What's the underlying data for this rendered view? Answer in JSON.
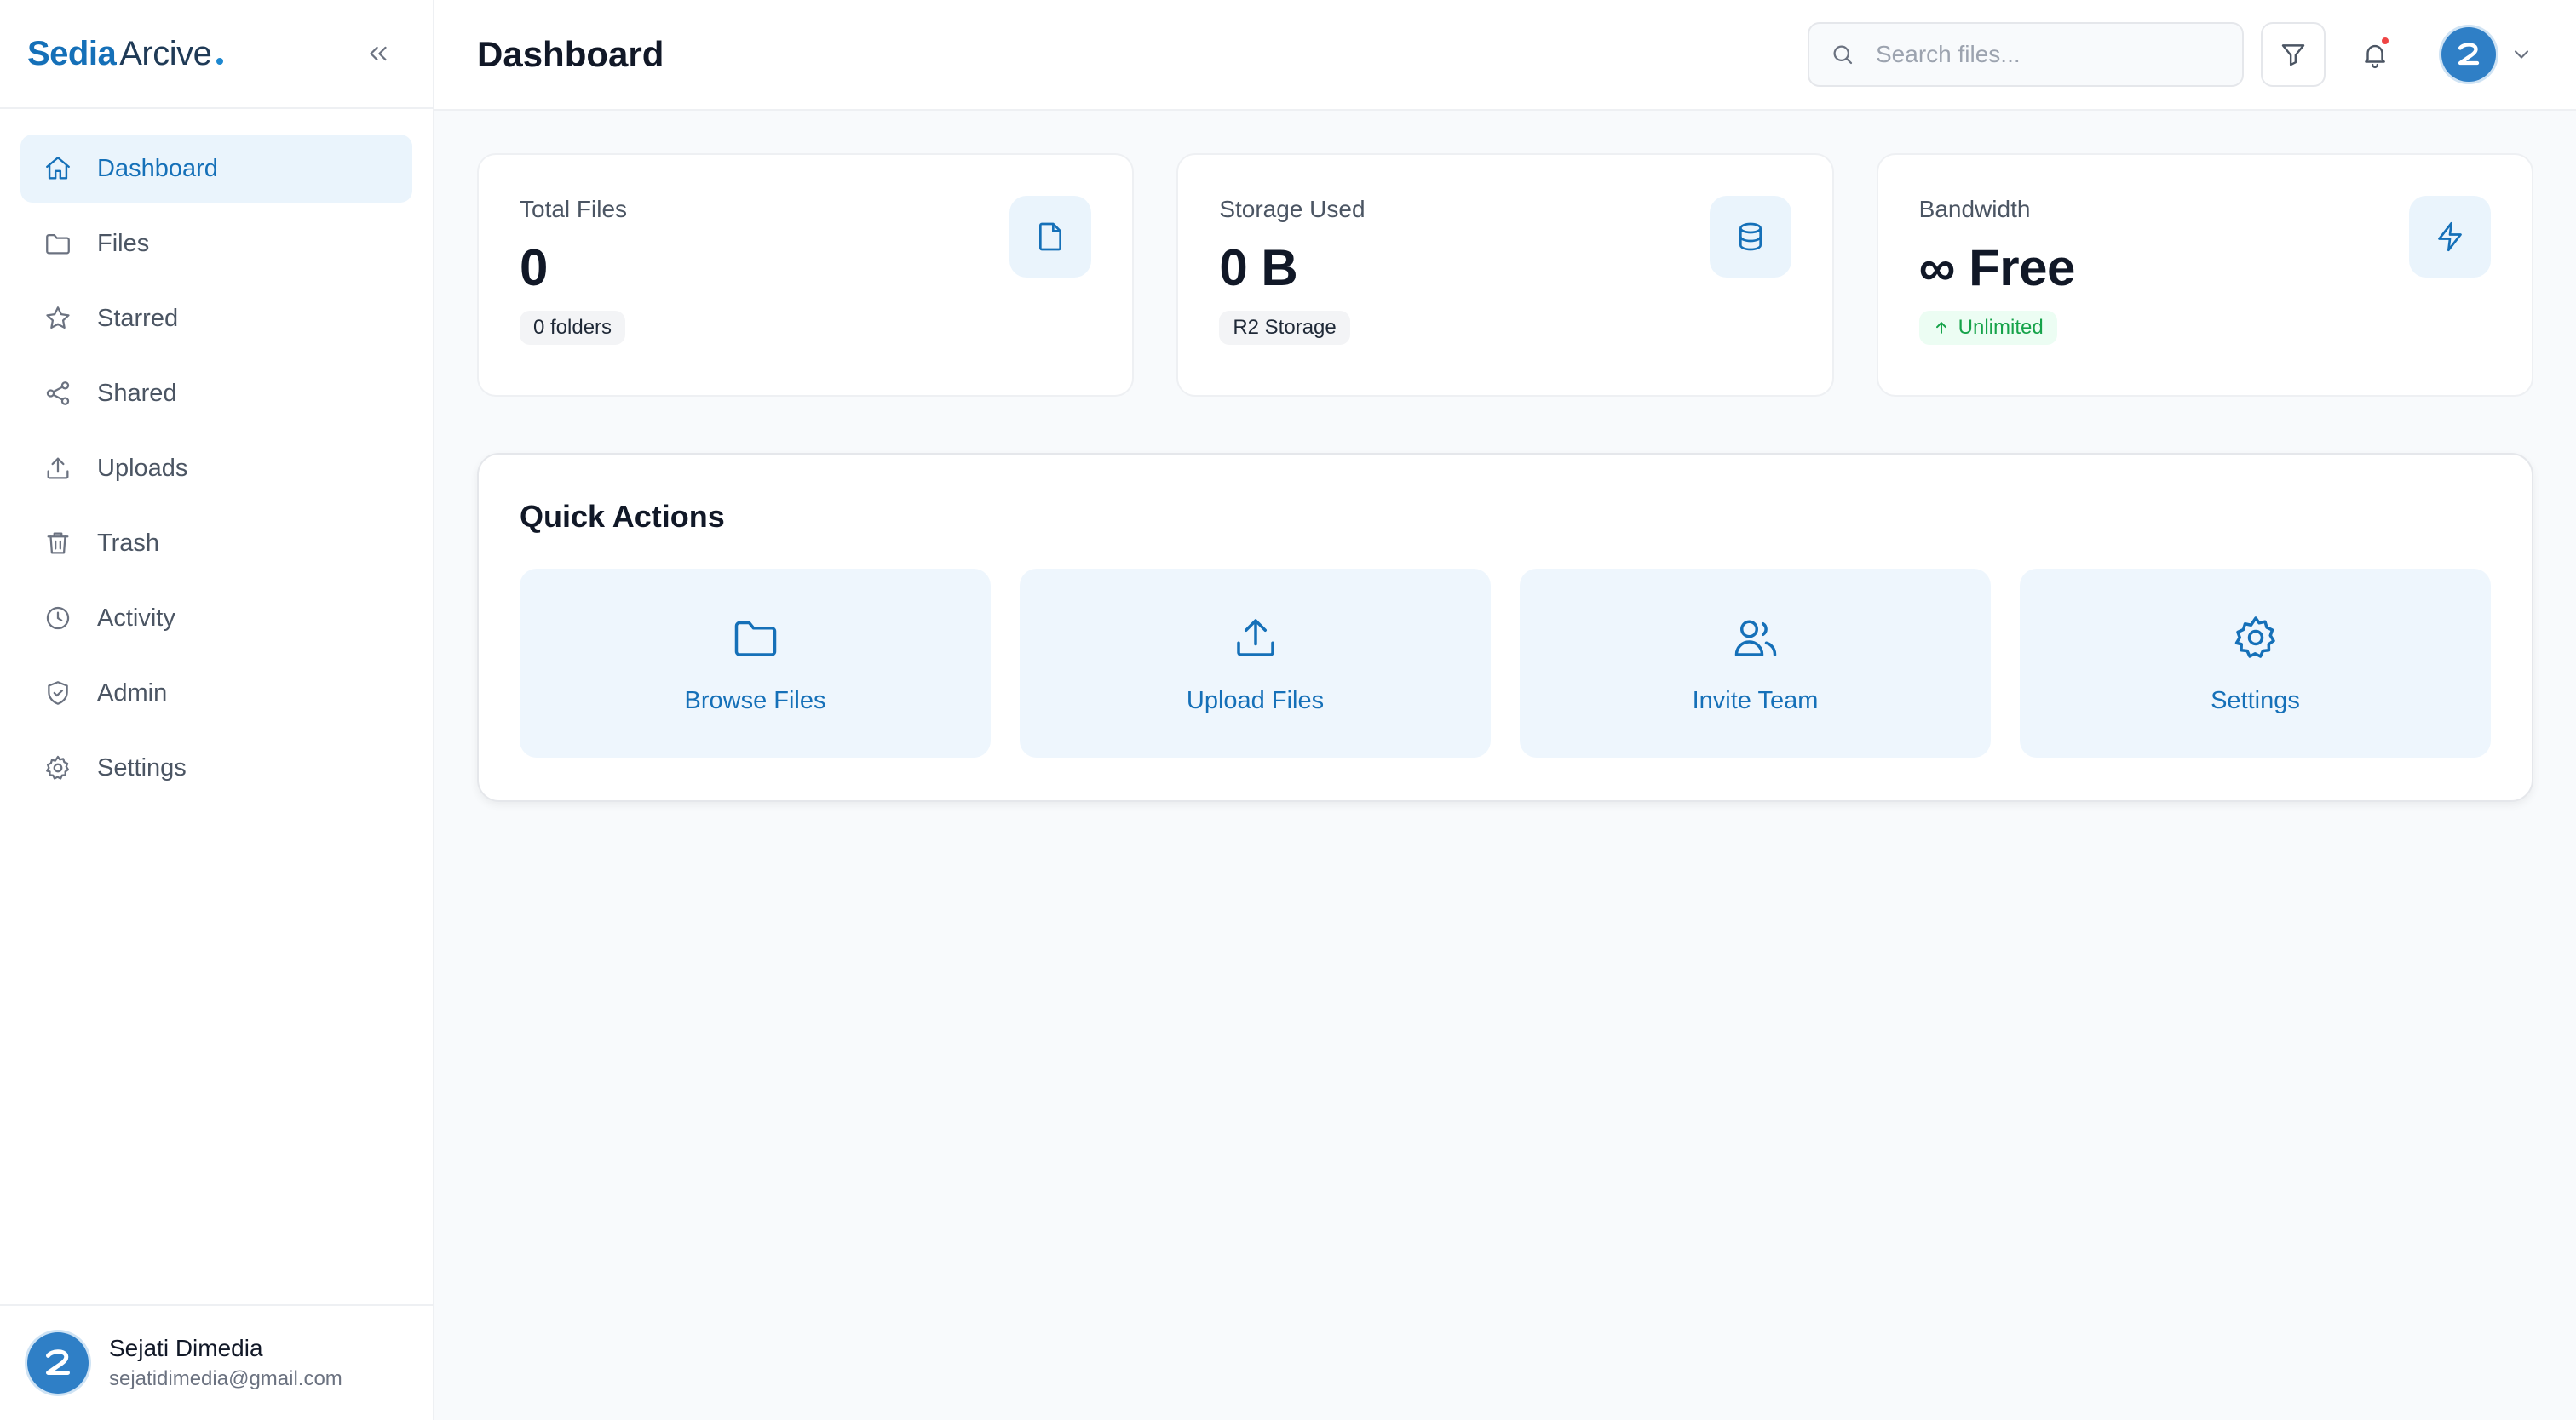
{
  "brand": {
    "name_part1": "Sedia",
    "name_part2": "Arcive"
  },
  "sidebar": {
    "items": [
      {
        "label": "Dashboard",
        "icon": "home-icon",
        "active": true
      },
      {
        "label": "Files",
        "icon": "folder-icon"
      },
      {
        "label": "Starred",
        "icon": "star-icon"
      },
      {
        "label": "Shared",
        "icon": "share-icon"
      },
      {
        "label": "Uploads",
        "icon": "upload-icon"
      },
      {
        "label": "Trash",
        "icon": "trash-icon"
      },
      {
        "label": "Activity",
        "icon": "clock-icon"
      },
      {
        "label": "Admin",
        "icon": "shield-icon"
      },
      {
        "label": "Settings",
        "icon": "gear-icon"
      }
    ],
    "user": {
      "name": "Sejati Dimedia",
      "email": "sejatidimedia@gmail.com"
    }
  },
  "header": {
    "title": "Dashboard",
    "search_placeholder": "Search files..."
  },
  "stats": [
    {
      "label": "Total Files",
      "value": "0",
      "badge": "0 folders",
      "icon": "file-icon"
    },
    {
      "label": "Storage Used",
      "value": "0 B",
      "badge": "R2 Storage",
      "icon": "database-icon"
    },
    {
      "label": "Bandwidth",
      "value": "∞ Free",
      "badge": "Unlimited",
      "badge_icon": "arrow-up-icon",
      "icon": "lightning-icon"
    }
  ],
  "quick_actions": {
    "title": "Quick Actions",
    "items": [
      {
        "label": "Browse Files",
        "icon": "folder-icon"
      },
      {
        "label": "Upload Files",
        "icon": "upload-icon"
      },
      {
        "label": "Invite Team",
        "icon": "users-icon"
      },
      {
        "label": "Settings",
        "icon": "gear-icon"
      }
    ]
  },
  "colors": {
    "accent": "#1570b8",
    "accent_bg": "#eaf4fc",
    "success": "#16a34a",
    "alert": "#ef4444"
  }
}
